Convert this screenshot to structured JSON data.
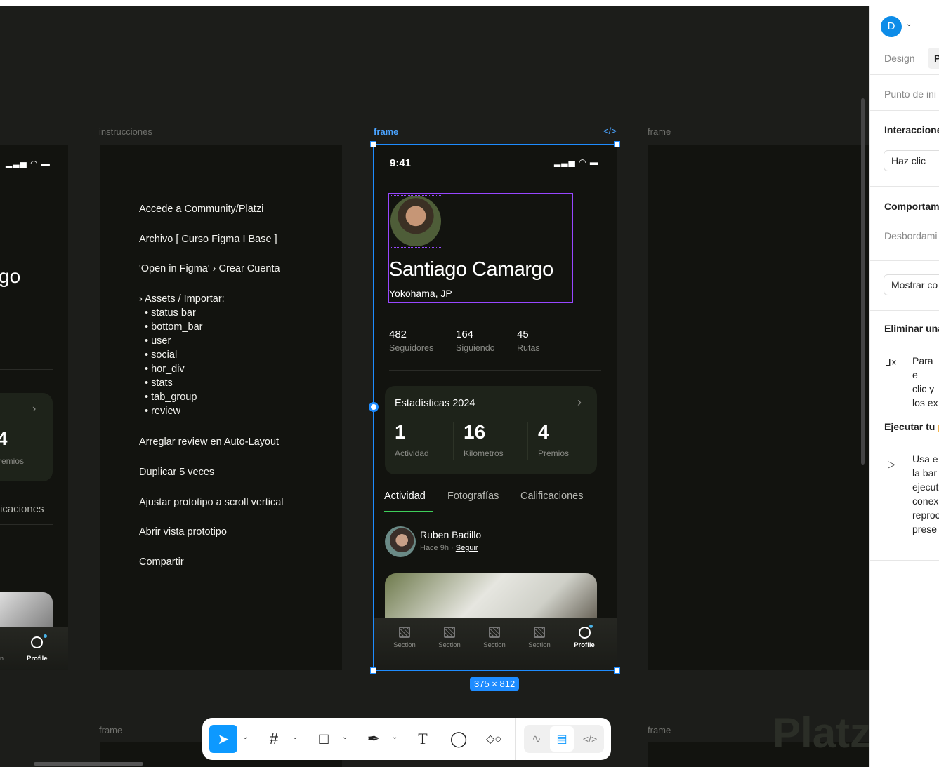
{
  "canvas": {
    "left_frame_partial_title": "go",
    "left_frame_stat": "4",
    "left_frame_stat_label": "remios",
    "left_frame_tab": "icaciones",
    "left_nav_partial": "n",
    "left_nav_profile": "Profile",
    "frame_labels": [
      "instrucciones",
      "frame",
      "frame",
      "frame",
      "frame"
    ]
  },
  "instructions": {
    "steps": [
      "Accede a Community/Platzi",
      "Archivo [ Curso Figma I Base ]",
      "'Open in Figma' › Crear Cuenta",
      "› Assets / Importar:"
    ],
    "assets": [
      "status bar",
      "bottom_bar",
      "user",
      "social",
      "hor_div",
      "stats",
      "tab_group",
      "review"
    ],
    "steps2": [
      "Arreglar review en Auto-Layout",
      "Duplicar 5 veces",
      "Ajustar prototipo a scroll vertical",
      "Abrir vista prototipo",
      "Compartir"
    ]
  },
  "phone": {
    "label": "frame",
    "code_icon": "</>",
    "time": "9:41",
    "name": "Santiago Camargo",
    "location": "Yokohama, JP",
    "stats": [
      {
        "value": "482",
        "label": "Seguidores"
      },
      {
        "value": "164",
        "label": "Siguiendo"
      },
      {
        "value": "45",
        "label": "Rutas"
      }
    ],
    "card": {
      "title": "Estadísticas 2024",
      "items": [
        {
          "value": "1",
          "label": "Actividad"
        },
        {
          "value": "16",
          "label": "Kilometros"
        },
        {
          "value": "4",
          "label": "Premios"
        }
      ]
    },
    "tabs": [
      "Actividad",
      "Fotografías",
      "Calificaciones"
    ],
    "post": {
      "user": "Ruben Badillo",
      "time": "Hace 9h",
      "follow": "Seguir"
    },
    "nav": [
      "Section",
      "Section",
      "Section",
      "Section",
      "Profile"
    ],
    "size": "375 × 812"
  },
  "panel": {
    "avatar": "D",
    "tabs": [
      "Design",
      "P"
    ],
    "start": "Punto de ini",
    "interactions": "Interaccione",
    "trigger": "Haz clic",
    "behavior": "Comportam",
    "overflow": "Desbordami",
    "show": "Mostrar co",
    "delete_title": "Eliminar una",
    "delete_text": [
      "Para e",
      "clic y",
      "los ex"
    ],
    "run_title": "Ejecutar tu",
    "run_text": [
      "Usa e",
      "la bar",
      "ejecut",
      "conex",
      "reproc",
      "prese"
    ]
  },
  "watermark": "Platzi",
  "colors": {
    "selection": "#1e8cff",
    "component": "#9747ff",
    "accent_tab": "#3ecf5a"
  }
}
